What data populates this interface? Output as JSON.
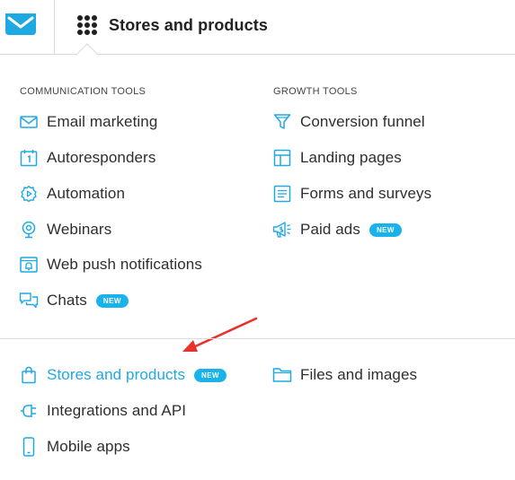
{
  "header": {
    "menu_title": "Stores and products",
    "logo_icon": "envelope-logo-icon",
    "apps_icon": "grid-dots-icon"
  },
  "colors": {
    "accent": "#1fa9e2",
    "badge": "#19b3ea",
    "arrow": "#e8322c"
  },
  "communication_tools": {
    "title": "COMMUNICATION TOOLS",
    "items": [
      {
        "label": "Email marketing",
        "icon": "envelope-icon"
      },
      {
        "label": "Autoresponders",
        "icon": "calendar-icon"
      },
      {
        "label": "Automation",
        "icon": "gear-play-icon"
      },
      {
        "label": "Webinars",
        "icon": "webcam-icon"
      },
      {
        "label": "Web push notifications",
        "icon": "browser-bell-icon"
      },
      {
        "label": "Chats",
        "icon": "chat-bubbles-icon",
        "badge": "NEW"
      }
    ]
  },
  "growth_tools": {
    "title": "GROWTH TOOLS",
    "items": [
      {
        "label": "Conversion funnel",
        "icon": "funnel-icon"
      },
      {
        "label": "Landing pages",
        "icon": "layout-icon"
      },
      {
        "label": "Forms and surveys",
        "icon": "form-icon"
      },
      {
        "label": "Paid ads",
        "icon": "megaphone-icon",
        "badge": "NEW"
      }
    ]
  },
  "bottom": {
    "left_items": [
      {
        "label": "Stores and products",
        "icon": "shopping-bag-icon",
        "badge": "NEW",
        "active": true
      },
      {
        "label": "Integrations and API",
        "icon": "plug-icon"
      },
      {
        "label": "Mobile apps",
        "icon": "smartphone-icon"
      }
    ],
    "right_items": [
      {
        "label": "Files and images",
        "icon": "folder-icon"
      }
    ]
  }
}
